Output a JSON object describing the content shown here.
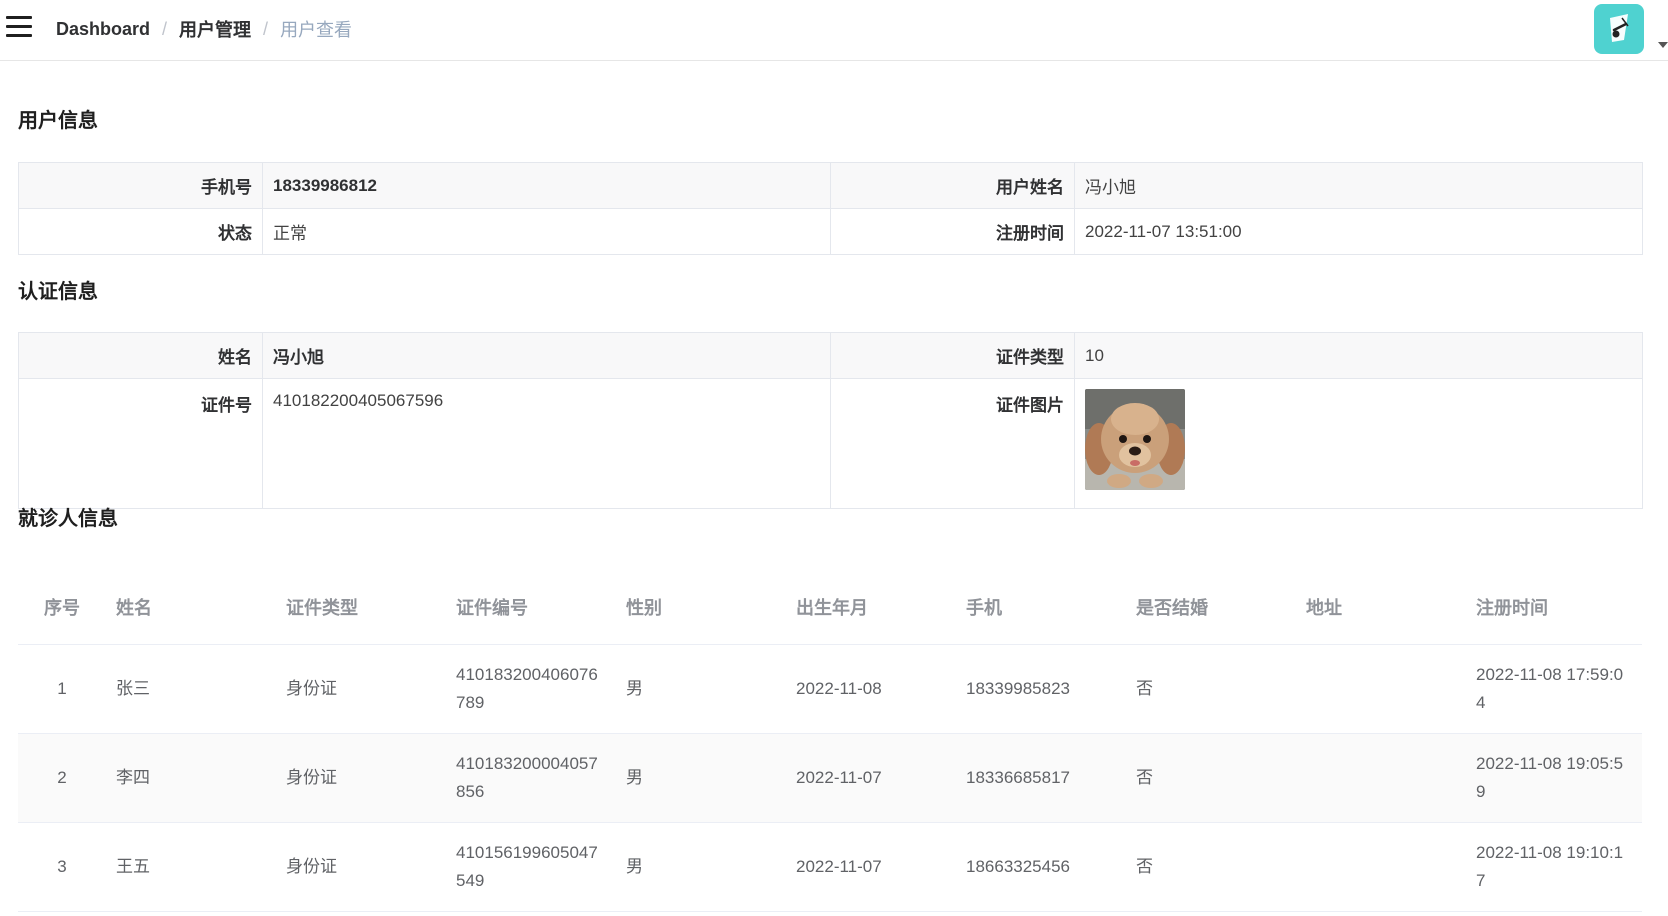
{
  "header": {
    "breadcrumb": [
      "Dashboard",
      "用户管理",
      "用户查看"
    ]
  },
  "user_info": {
    "title": "用户信息",
    "phone_label": "手机号",
    "phone": "18339986812",
    "name_label": "用户姓名",
    "name": "冯小旭",
    "status_label": "状态",
    "status": "正常",
    "register_label": "注册时间",
    "register_time": "2022-11-07 13:51:00"
  },
  "auth_info": {
    "title": "认证信息",
    "name_label": "姓名",
    "name": "冯小旭",
    "cert_type_label": "证件类型",
    "cert_type": "10",
    "cert_no_label": "证件号",
    "cert_no": "410182200405067596",
    "cert_image_label": "证件图片"
  },
  "patients": {
    "title": "就诊人信息",
    "columns": [
      "序号",
      "姓名",
      "证件类型",
      "证件编号",
      "性别",
      "出生年月",
      "手机",
      "是否结婚",
      "地址",
      "注册时间"
    ],
    "rows": [
      {
        "index": "1",
        "name": "张三",
        "cert_type": "身份证",
        "cert_no": "410183200406076789",
        "sex": "男",
        "birth": "2022-11-08",
        "phone": "18339985823",
        "married": "否",
        "address": "",
        "register": "2022-11-08 17:59:04"
      },
      {
        "index": "2",
        "name": "李四",
        "cert_type": "身份证",
        "cert_no": "410183200004057856",
        "sex": "男",
        "birth": "2022-11-07",
        "phone": "18336685817",
        "married": "否",
        "address": "",
        "register": "2022-11-08 19:05:59"
      },
      {
        "index": "3",
        "name": "王五",
        "cert_type": "身份证",
        "cert_no": "410156199605047549",
        "sex": "男",
        "birth": "2022-11-07",
        "phone": "18663325456",
        "married": "否",
        "address": "",
        "register": "2022-11-08 19:10:17"
      }
    ]
  },
  "icons": {
    "menu": "hamburger-icon",
    "avatar": "avatar-image",
    "dropdown": "caret-down-icon",
    "id_photo": "dog-photo"
  },
  "colors": {
    "avatar_bg": "#4fd2d0",
    "border": "#e4e7ed",
    "header_text": "#909399"
  }
}
